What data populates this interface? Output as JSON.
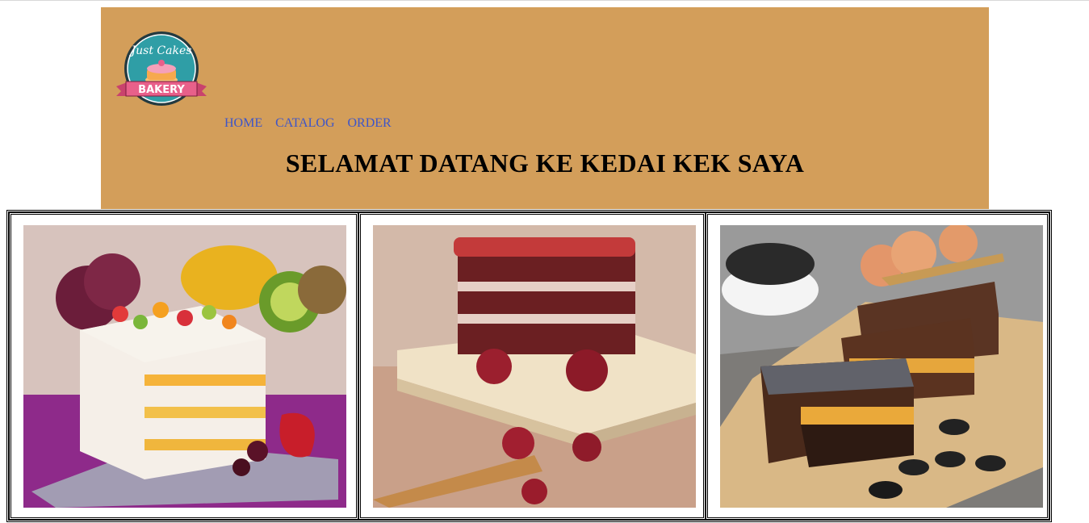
{
  "logo": {
    "line1": "Just Cakes",
    "line2": "BAKERY"
  },
  "nav": {
    "items": [
      "HOME",
      "CATALOG",
      "ORDER"
    ]
  },
  "page_title": "SELAMAT DATANG KE KEDAI KEK SAYA",
  "gallery": [
    "fruit-cake-image",
    "red-velvet-cake-image",
    "chocolate-mousse-cake-image"
  ],
  "colors": {
    "header_bg": "#d39e5a",
    "link": "#3d55c9",
    "logo_teal": "#2f9ea6",
    "logo_pink": "#e8608a"
  }
}
